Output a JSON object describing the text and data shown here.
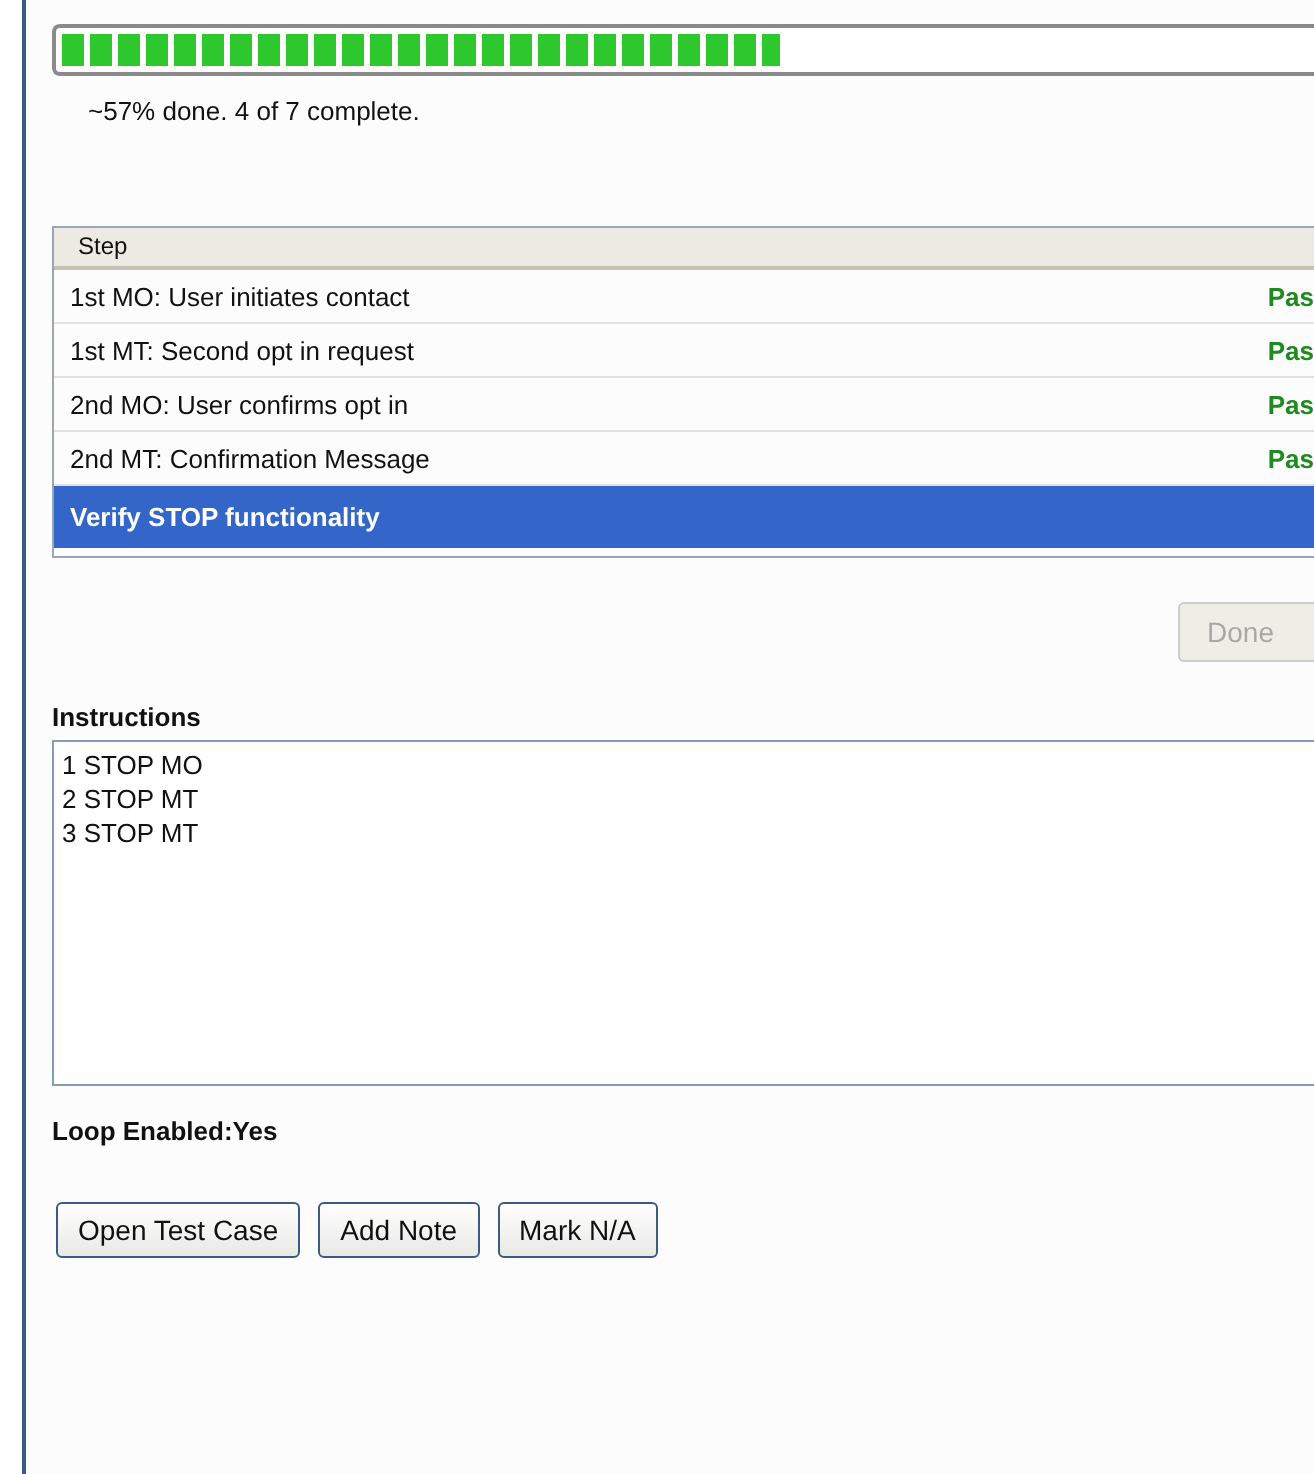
{
  "progress": {
    "level": 0.57,
    "caption": "~57% done. 4 of 7 complete."
  },
  "table": {
    "columns": [
      "Step"
    ],
    "rows": [
      {
        "step": "1st MO: User initiates contact",
        "status": "Pas",
        "selected": false
      },
      {
        "step": "1st MT: Second opt in request",
        "status": "Pas",
        "selected": false
      },
      {
        "step": "2nd MO: User confirms opt in",
        "status": "Pas",
        "selected": false
      },
      {
        "step": "2nd MT: Confirmation Message",
        "status": "Pas",
        "selected": false
      },
      {
        "step": "Verify STOP functionality",
        "selected": true
      }
    ]
  },
  "done_button": {
    "label": "Done",
    "disabled": true
  },
  "instructions": {
    "label": "Instructions",
    "value": "1 STOP MO\n2 STOP MT\n3 STOP MT"
  },
  "loop": "Loop Enabled:Yes",
  "buttons": [
    "Open Test Case",
    "Add Note",
    "Mark N/A"
  ]
}
